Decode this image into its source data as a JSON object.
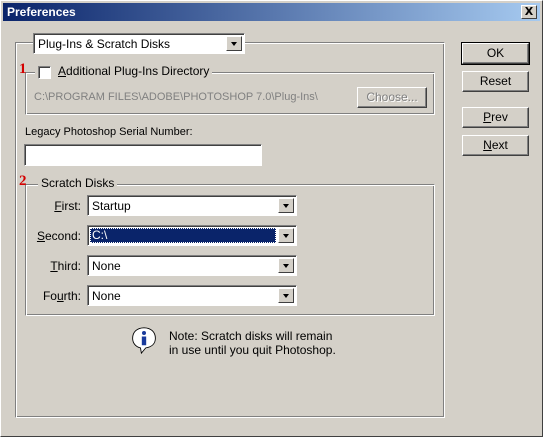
{
  "window": {
    "title": "Preferences",
    "close_label": "X"
  },
  "panel_select": {
    "value": "Plug-Ins & Scratch Disks"
  },
  "markers": {
    "one": "1",
    "two": "2"
  },
  "plugins": {
    "checkbox_label": "Additional Plug-Ins Directory",
    "checkbox_mnemonic": "A",
    "checkbox_rest": "dditional Plug-Ins Directory",
    "checked": false,
    "path": "C:\\PROGRAM FILES\\ADOBE\\PHOTOSHOP 7.0\\Plug-Ins\\",
    "choose_label": "Choose..."
  },
  "serial": {
    "label": "Legacy Photoshop Serial Number:",
    "value": ""
  },
  "scratch": {
    "group_label": "Scratch Disks",
    "rows": [
      {
        "label_mnemonic": "F",
        "label_rest": "irst:",
        "value": "Startup",
        "selected": false
      },
      {
        "label_mnemonic": "S",
        "label_rest": "econd:",
        "value": "C:\\",
        "selected": true
      },
      {
        "label_mnemonic": "T",
        "label_rest": "hird:",
        "value": "None",
        "selected": false
      },
      {
        "label_pre": "Fo",
        "label_mnemonic": "u",
        "label_rest": "rth:",
        "value": "None",
        "selected": false
      }
    ],
    "note_line1": "Note: Scratch disks will remain",
    "note_line2": "in use until you quit Photoshop."
  },
  "buttons": {
    "ok": "OK",
    "reset": "Reset",
    "prev_mnemonic": "P",
    "prev_rest": "rev",
    "next_mnemonic": "N",
    "next_rest": "ext"
  },
  "colors": {
    "titlebar_start": "#0a246a",
    "titlebar_end": "#a6caf0",
    "marker": "#d40000",
    "selection": "#0a246a"
  },
  "icons": {
    "info": "info-icon",
    "close": "close-icon",
    "dropdown": "chevron-down-icon"
  }
}
